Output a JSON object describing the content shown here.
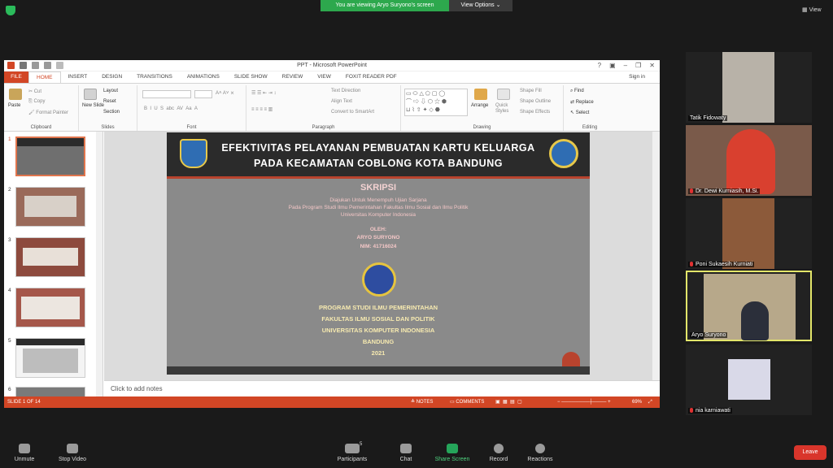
{
  "zoom_banner": {
    "viewing": "You are viewing Aryo Suryono's screen",
    "view_options": "View Options",
    "view": "View"
  },
  "ppt": {
    "title": "PPT - Microsoft PowerPoint",
    "tabs": [
      "FILE",
      "HOME",
      "INSERT",
      "DESIGN",
      "TRANSITIONS",
      "ANIMATIONS",
      "SLIDE SHOW",
      "REVIEW",
      "VIEW",
      "FOXIT READER PDF"
    ],
    "sign_in": "Sign in",
    "ribbon": {
      "clipboard": {
        "label": "Clipboard",
        "paste": "Paste",
        "cut": "Cut",
        "copy": "Copy",
        "format_painter": "Format Painter"
      },
      "slides": {
        "label": "Slides",
        "new_slide": "New Slide",
        "layout": "Layout",
        "reset": "Reset",
        "section": "Section"
      },
      "font": {
        "label": "Font"
      },
      "paragraph": {
        "label": "Paragraph",
        "text_direction": "Text Direction",
        "align_text": "Align Text",
        "smartart": "Convert to SmartArt"
      },
      "drawing": {
        "label": "Drawing",
        "arrange": "Arrange",
        "quick_styles": "Quick Styles",
        "shape_fill": "Shape Fill",
        "shape_outline": "Shape Outline",
        "shape_effects": "Shape Effects"
      },
      "editing": {
        "label": "Editing",
        "find": "Find",
        "replace": "Replace",
        "select": "Select"
      }
    },
    "slide_numbers": [
      "1",
      "2",
      "3",
      "4",
      "5",
      "6"
    ],
    "slide": {
      "title_line1": "EFEKTIVITAS PELAYANAN PEMBUATAN KARTU KELUARGA",
      "title_line2": "PADA KECAMATAN COBLONG KOTA BANDUNG",
      "skripsi": "SKRIPSI",
      "sub1": "Diajukan Untuk Menempuh Ujian Sarjana",
      "sub2": "Pada Program Studi Ilmu Pemerintahan Fakultas Ilmu Sosial dan Ilmu Politik",
      "sub3": "Universitas Komputer Indonesia",
      "oleh": "OLEH:",
      "name": "ARYO SURYONO",
      "nim": "NIM: 41716024",
      "prog": "PROGRAM STUDI ILMU PEMERINTAHAN",
      "fak": "FAKULTAS ILMU SOSIAL DAN POLITIK",
      "univ": "UNIVERSITAS KOMPUTER INDONESIA",
      "city": "BANDUNG",
      "year": "2021"
    },
    "notes_placeholder": "Click to add notes",
    "status": {
      "slide_of": "SLIDE 1 OF 14",
      "notes": "NOTES",
      "comments": "COMMENTS",
      "zoom": "69%"
    }
  },
  "participants_tiles": [
    {
      "name": "Tatik Fidowaty"
    },
    {
      "name": "Dr. Dewi Kurniasih, M.Si."
    },
    {
      "name": "Poni Sukaesih Kurniati"
    },
    {
      "name": "Aryo Suryono"
    },
    {
      "name": "nia karniawati"
    }
  ],
  "toolbar": {
    "unmute": "Unmute",
    "stop_video": "Stop Video",
    "participants": "Participants",
    "participants_count": "5",
    "chat": "Chat",
    "share": "Share Screen",
    "record": "Record",
    "reactions": "Reactions",
    "leave": "Leave"
  }
}
